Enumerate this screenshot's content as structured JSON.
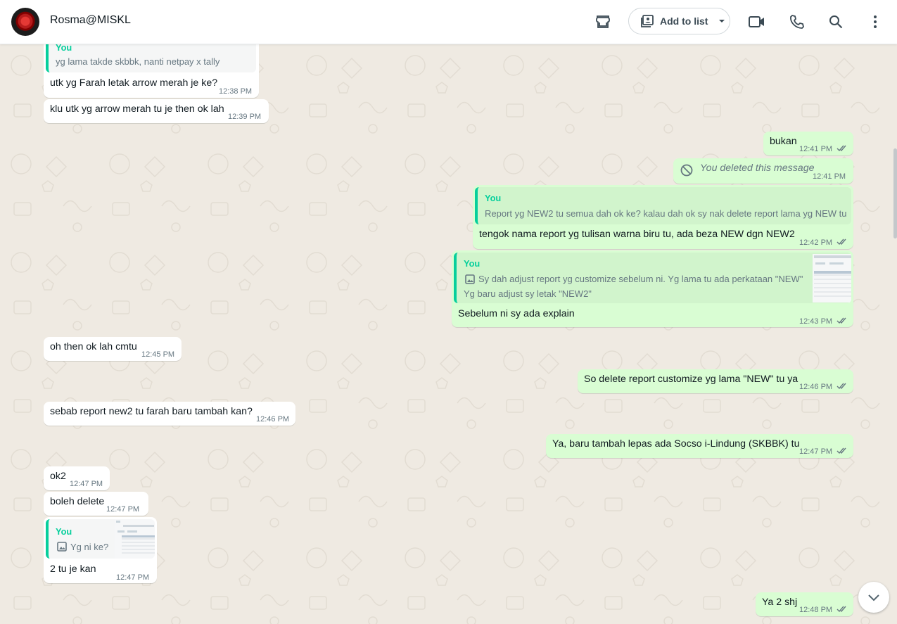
{
  "header": {
    "contact_name": "Rosma@MISKL",
    "add_to_list_label": "Add to list"
  },
  "icons": [
    "catalog-icon",
    "add-to-list-icon",
    "chevron-down-icon",
    "video-call-icon",
    "phone-icon",
    "search-icon",
    "menu-icon",
    "read-receipt-icon",
    "deleted-icon",
    "image-icon",
    "scroll-down-icon"
  ],
  "colors": {
    "outgoing": "#d9fdd3",
    "incoming": "#ffffff",
    "quote_accent": "#06cf9c",
    "background": "#efeae2"
  },
  "messages": {
    "m0": {
      "quote_name": "You",
      "quote_text": "yg lama takde skbbk, nanti netpay x tally"
    },
    "m1": {
      "text": "utk yg Farah letak arrow merah je ke?",
      "time": "12:38 PM"
    },
    "m2": {
      "text": "klu utk yg arrow merah tu je then ok lah",
      "time": "12:39 PM"
    },
    "m3": {
      "text": "bukan",
      "time": "12:41 PM"
    },
    "m4": {
      "text": "You deleted this message",
      "time": "12:41 PM"
    },
    "m5": {
      "quote_name": "You",
      "quote_text": "Report yg NEW2 tu semua dah ok ke? kalau dah ok sy nak delete report lama yg NEW tu",
      "text": "tengok nama report yg tulisan warna biru tu, ada beza NEW dgn NEW2",
      "time": "12:42 PM"
    },
    "m6": {
      "quote_name": "You",
      "quote_line1": "Sy dah adjust report yg customize sebelum ni. Yg lama tu ada perkataan \"NEW\"",
      "quote_line2": "Yg baru adjust sy letak \"NEW2\"",
      "text": "Sebelum ni sy ada explain",
      "time": "12:43 PM"
    },
    "m7": {
      "text": "oh then ok lah cmtu",
      "time": "12:45 PM"
    },
    "m8": {
      "text": "So delete report customize yg lama \"NEW\" tu ya",
      "time": "12:46 PM"
    },
    "m9": {
      "text": "sebab report new2 tu farah baru tambah kan?",
      "time": "12:46 PM"
    },
    "m10": {
      "text": "Ya, baru tambah lepas ada Socso i-Lindung (SKBBK) tu",
      "time": "12:47 PM"
    },
    "m11": {
      "text": "ok2",
      "time": "12:47 PM"
    },
    "m12": {
      "text": "boleh delete",
      "time": "12:47 PM"
    },
    "m13": {
      "quote_name": "You",
      "quote_text": "Yg ni ke?",
      "text": "2 tu je kan",
      "time": "12:47 PM"
    },
    "m14": {
      "text": "Ya 2 shj",
      "time": "12:48 PM"
    }
  }
}
